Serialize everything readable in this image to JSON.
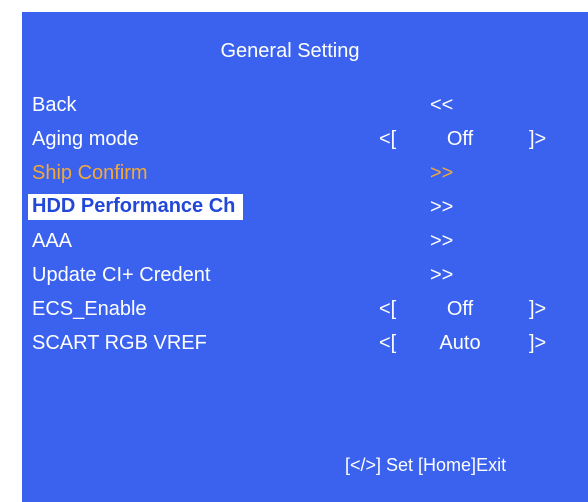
{
  "menu": {
    "title": "General Setting",
    "items": [
      {
        "label": "Back",
        "action": "<<"
      },
      {
        "label": "Aging mode",
        "left": "<[",
        "value": "Off",
        "right": "]>"
      },
      {
        "label": "Ship Confirm",
        "action": ">>"
      },
      {
        "label": "HDD Performance Ch",
        "action": ">>"
      },
      {
        "label": "AAA",
        "action": ">>"
      },
      {
        "label": "Update CI+ Credent",
        "action": ">>"
      },
      {
        "label": "ECS_Enable",
        "left": "<[",
        "value": "Off",
        "right": "]>"
      },
      {
        "label": "SCART RGB VREF",
        "left": "<[",
        "value": "Auto",
        "right": "]>"
      }
    ],
    "footer": "[</>] Set [Home]Exit"
  },
  "colors": {
    "background": "#3a62ee",
    "text": "#ffffff",
    "active_item": "#f2a93a",
    "highlight_bg": "#ffffff",
    "highlight_text": "#2348d8"
  }
}
